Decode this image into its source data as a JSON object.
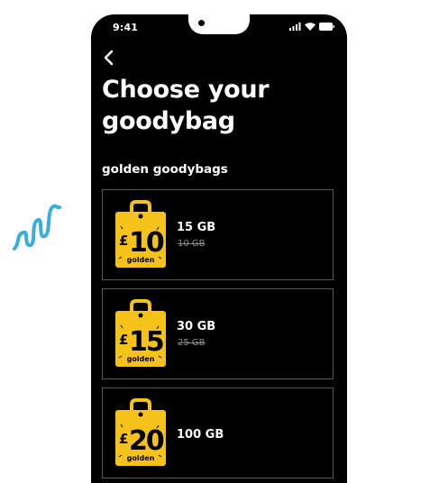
{
  "status": {
    "time": "9:41"
  },
  "page": {
    "title_line1": "Choose your",
    "title_line2": "goodybag",
    "section": "golden goodybags"
  },
  "bags": [
    {
      "price": "10",
      "currency": "£",
      "tier": "golden",
      "data": "15 GB",
      "old_data": "10 GB"
    },
    {
      "price": "15",
      "currency": "£",
      "tier": "golden",
      "data": "30 GB",
      "old_data": "25 GB"
    },
    {
      "price": "20",
      "currency": "£",
      "tier": "golden",
      "data": "100 GB"
    }
  ],
  "colors": {
    "bag_yellow": "#f5c21a",
    "background": "#000000",
    "scribble": "#3aaed8"
  },
  "icons": [
    "back-chevron-icon",
    "signal-icon",
    "wifi-icon",
    "battery-icon"
  ]
}
